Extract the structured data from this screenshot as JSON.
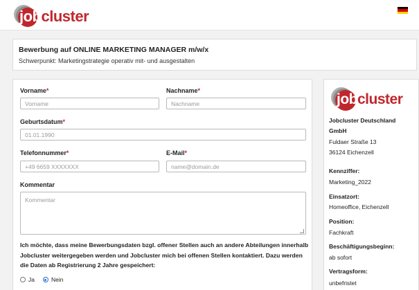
{
  "brand": {
    "logo_job": "job",
    "logo_cluster": "cluster",
    "colors": {
      "accent": "#c0272d",
      "logo_grey": "#9a9a9a",
      "radio": "#2a6fd8"
    }
  },
  "language": {
    "icon": "german-flag-icon",
    "colors": [
      "#000000",
      "#dd0000",
      "#ffce00"
    ]
  },
  "job": {
    "title": "Bewerbung auf ONLINE MARKETING MANAGER m/w/x",
    "focus": "Schwerpunkt: Marketingstrategie operativ mit- und ausgestalten"
  },
  "form": {
    "first_name": {
      "label": "Vorname",
      "required": "*",
      "placeholder": "Vorname"
    },
    "last_name": {
      "label": "Nachname",
      "required": "*",
      "placeholder": "Nachname"
    },
    "birthdate": {
      "label": "Geburtsdatum",
      "required": "*",
      "placeholder": "01.01.1990"
    },
    "phone": {
      "label": "Telefonnummer",
      "required": "*",
      "placeholder": "+49 6659 XXXXXXX"
    },
    "email": {
      "label": "E-Mail",
      "required": "*",
      "placeholder": "name@domain.de"
    },
    "comment": {
      "label": "Kommentar",
      "placeholder": "Kommentar"
    },
    "consent": {
      "text": "Ich möchte, dass meine Bewerbungsdaten bzgl. offener Stellen auch an andere Abteilungen innerhalb Jobcluster weitergegeben werden und Jobcluster mich bei offenen Stellen kontaktiert. Dazu werden die Daten ab Registrierung 2 Jahre gespeichert:",
      "options": [
        {
          "label": "Ja",
          "selected": false
        },
        {
          "label": "Nein",
          "selected": true
        }
      ]
    }
  },
  "company": {
    "name_line1": "Jobcluster Deutschland",
    "name_line2": "GmbH",
    "street": "Fuldaer Straße 13",
    "city": "36124 Eichenzell",
    "details": [
      {
        "label": "Kennziffer:",
        "value": "Marketing_2022"
      },
      {
        "label": "Einsatzort:",
        "value": "Homeoffice, Eichenzell"
      },
      {
        "label": "Position:",
        "value": "Fachkraft"
      },
      {
        "label": "Beschäftigungsbeginn:",
        "value": "ab sofort"
      },
      {
        "label": "Vertragsform:",
        "value": "unbefristet"
      }
    ]
  }
}
